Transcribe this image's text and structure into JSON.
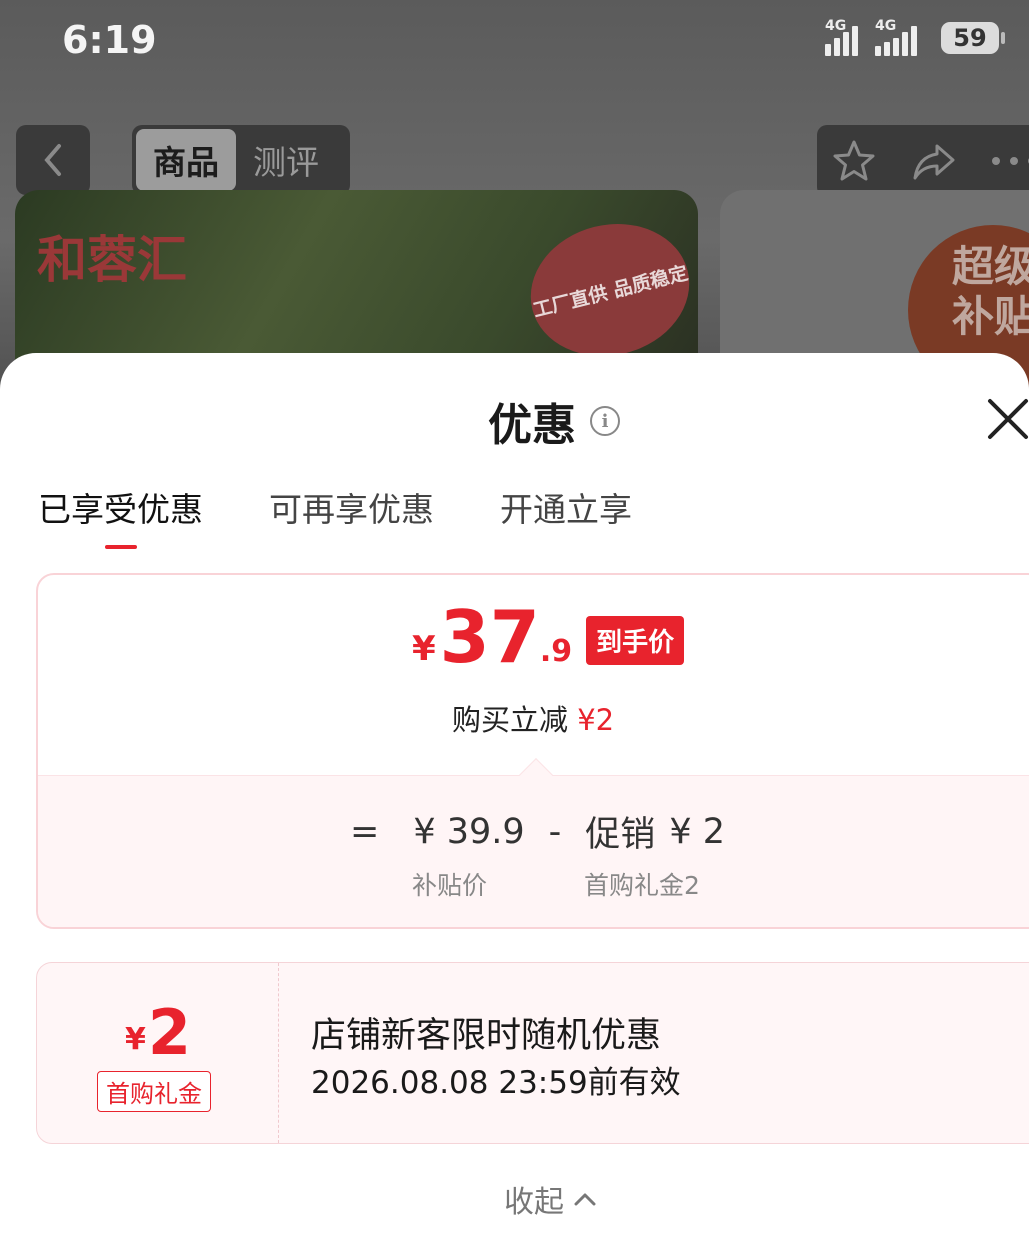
{
  "status_bar": {
    "time": "6:19",
    "network_1": "4G",
    "network_2": "4G",
    "battery": "59"
  },
  "background": {
    "nav_tabs": [
      {
        "label": "商品",
        "active": true
      },
      {
        "label": "测评",
        "active": false
      }
    ],
    "hero_logo": "和蓉汇",
    "hero_badge": "工厂直供 品质稳定",
    "side_text": "超级补贴"
  },
  "sheet": {
    "title": "优惠",
    "tabs": [
      {
        "label": "已享受优惠",
        "active": true
      },
      {
        "label": "可再享优惠",
        "active": false
      },
      {
        "label": "开通立享",
        "active": false
      }
    ],
    "price_card": {
      "currency": "¥",
      "price_int": "37",
      "price_dec": ".9",
      "final_badge": "到手价",
      "reduce_label": "购买立减",
      "reduce_amount": "¥2",
      "formula": {
        "equals": "=",
        "base_price": "¥ 39.9",
        "minus": "-",
        "promo_label": "促销",
        "promo_amount": "¥ 2",
        "base_label": "补贴价",
        "promo_sub_label": "首购礼金2"
      }
    },
    "coupon": {
      "currency": "¥",
      "amount": "2",
      "tag": "首购礼金",
      "title": "店铺新客限时随机优惠",
      "validity": "2026.08.08 23:59前有效"
    },
    "collapse_label": "收起"
  },
  "colors": {
    "accent": "#e8232d",
    "sheet_bg": "#ffffff",
    "pink_bg": "#fff5f6"
  }
}
